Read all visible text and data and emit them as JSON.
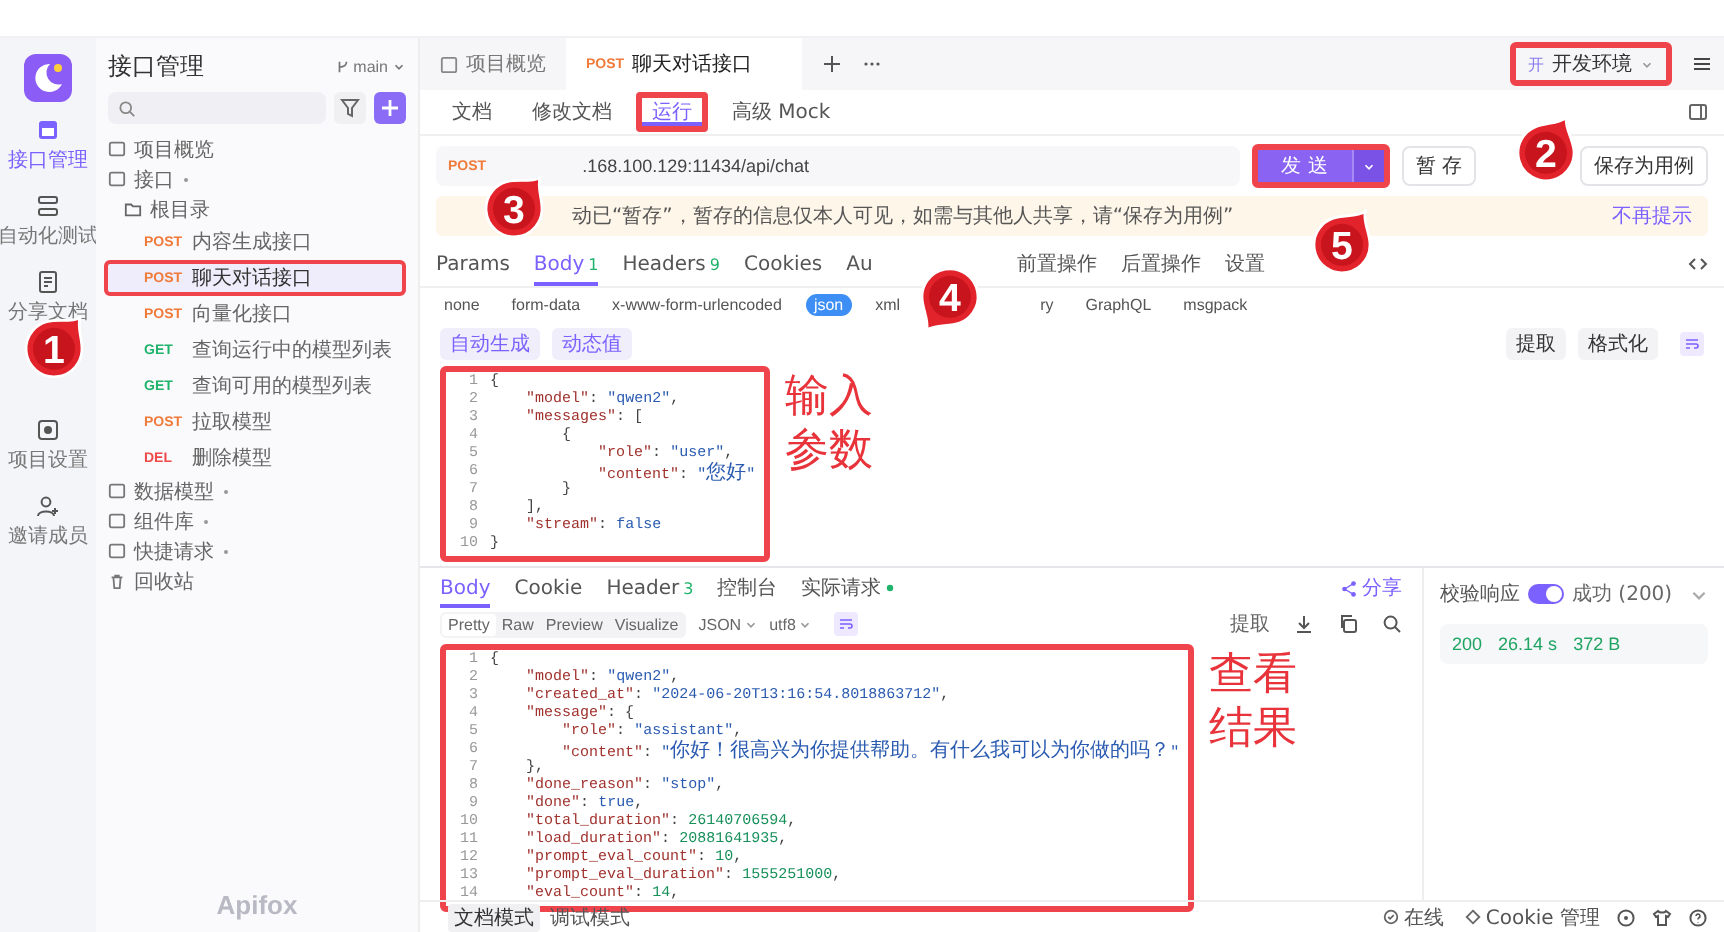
{
  "rail": {
    "items": [
      {
        "label": "接口管理",
        "selected": true
      },
      {
        "label": "自动化测试",
        "selected": false
      },
      {
        "label": "分享文档",
        "selected": false
      },
      {
        "label": "项目设置",
        "selected": false
      },
      {
        "label": "邀请成员",
        "selected": false
      }
    ]
  },
  "sidebar": {
    "title": "接口管理",
    "branch": "main",
    "tree": [
      {
        "label": "项目概览",
        "kind": "page"
      },
      {
        "label": "接口",
        "kind": "api",
        "children": [
          {
            "label": "根目录",
            "children": [
              {
                "method": "POST",
                "color": "#f07a3a",
                "label": "内容生成接口",
                "selected": false,
                "highlighted": false
              },
              {
                "method": "POST",
                "color": "#f07a3a",
                "label": "聊天对话接口",
                "selected": true,
                "highlighted": true
              },
              {
                "method": "POST",
                "color": "#f07a3a",
                "label": "向量化接口",
                "selected": false,
                "highlighted": false
              },
              {
                "method": "GET",
                "color": "#1fb36b",
                "label": "查询运行中的模型列表",
                "selected": false,
                "highlighted": false
              },
              {
                "method": "GET",
                "color": "#1fb36b",
                "label": "查询可用的模型列表",
                "selected": false,
                "highlighted": false
              },
              {
                "method": "POST",
                "color": "#f07a3a",
                "label": "拉取模型",
                "selected": false,
                "highlighted": false
              },
              {
                "method": "DEL",
                "color": "#ef4a4a",
                "label": "删除模型",
                "selected": false,
                "highlighted": false
              }
            ]
          }
        ]
      },
      {
        "label": "数据模型",
        "kind": "model"
      },
      {
        "label": "组件库",
        "kind": "lib"
      },
      {
        "label": "快捷请求",
        "kind": "quick"
      },
      {
        "label": "回收站",
        "kind": "trash"
      }
    ],
    "brand": "Apifox"
  },
  "tabs": [
    {
      "label": "项目概览",
      "selected": false
    },
    {
      "method": "POST",
      "label": "聊天对话接口",
      "selected": true
    }
  ],
  "environment": {
    "badge": "开",
    "label": "开发环境",
    "highlighted": true
  },
  "sub_tabs": [
    {
      "label": "文档",
      "selected": false,
      "highlighted": false
    },
    {
      "label": "修改文档",
      "selected": false,
      "highlighted": false
    },
    {
      "label": "运行",
      "selected": true,
      "highlighted": true
    },
    {
      "label": "高级 Mock",
      "selected": false,
      "highlighted": false
    }
  ],
  "request": {
    "method": "POST",
    "url": ".168.100.129:11434/api/chat",
    "send": "发 送",
    "send_highlighted": true,
    "save": "暂 存",
    "save_case": "保存为用例"
  },
  "notice": {
    "text": "动已“暂存”，暂存的信息仅本人可见，如需与其他人共享，请“保存为用例”",
    "dismiss": "不再提示"
  },
  "param_tabs": [
    {
      "label": "Params",
      "selected": false
    },
    {
      "label": "Body",
      "count": "1",
      "selected": true
    },
    {
      "label": "Headers",
      "count": "9",
      "selected": false
    },
    {
      "label": "Cookies",
      "selected": false
    },
    {
      "label": "Au",
      "selected": false
    },
    {
      "label": "前置操作",
      "selected": false
    },
    {
      "label": "后置操作",
      "selected": false
    },
    {
      "label": "设置",
      "selected": false
    }
  ],
  "body_types": [
    {
      "label": "none",
      "selected": false
    },
    {
      "label": "form-data",
      "selected": false
    },
    {
      "label": "x-www-form-urlencoded",
      "selected": false
    },
    {
      "label": "json",
      "selected": true
    },
    {
      "label": "xml",
      "selected": false
    },
    {
      "label": "ry",
      "selected": false
    },
    {
      "label": "GraphQL",
      "selected": false
    },
    {
      "label": "msgpack",
      "selected": false
    }
  ],
  "editor": {
    "auto": "自动生成",
    "dynamic": "动态值",
    "extract": "提取",
    "format": "格式化",
    "highlighted": true,
    "note": "输入参数",
    "lines": [
      {
        "n": "1",
        "code": "{"
      },
      {
        "n": "2",
        "code": "    \"model\": \"qwen2\","
      },
      {
        "n": "3",
        "code": "    \"messages\": ["
      },
      {
        "n": "4",
        "code": "        {"
      },
      {
        "n": "5",
        "code": "            \"role\": \"user\","
      },
      {
        "n": "6",
        "code": "            \"content\": \"您好\""
      },
      {
        "n": "7",
        "code": "        }"
      },
      {
        "n": "8",
        "code": "    ],"
      },
      {
        "n": "9",
        "code": "    \"stream\": false"
      },
      {
        "n": "10",
        "code": "}"
      }
    ]
  },
  "response": {
    "tabs": [
      {
        "label": "Body",
        "selected": true
      },
      {
        "label": "Cookie",
        "selected": false
      },
      {
        "label": "Header",
        "count": "3",
        "selected": false
      },
      {
        "label": "控制台",
        "selected": false
      },
      {
        "label": "实际请求",
        "dot": true,
        "selected": false
      }
    ],
    "share": "分享",
    "views": [
      {
        "label": "Pretty",
        "selected": true
      },
      {
        "label": "Raw",
        "selected": false
      },
      {
        "label": "Preview",
        "selected": false
      },
      {
        "label": "Visualize",
        "selected": false
      }
    ],
    "format": "JSON",
    "encoding": "utf8",
    "extract": "提取",
    "highlighted": true,
    "note": "查看结果",
    "lines": [
      {
        "n": "1",
        "code": "{"
      },
      {
        "n": "2",
        "code": "    \"model\": \"qwen2\","
      },
      {
        "n": "3",
        "code": "    \"created_at\": \"2024-06-20T13:16:54.8018863712\","
      },
      {
        "n": "4",
        "code": "    \"message\": {"
      },
      {
        "n": "5",
        "code": "        \"role\": \"assistant\","
      },
      {
        "n": "6",
        "code": "        \"content\": \"你好！很高兴为你提供帮助。有什么我可以为你做的吗？\""
      },
      {
        "n": "7",
        "code": "    },"
      },
      {
        "n": "8",
        "code": "    \"done_reason\": \"stop\","
      },
      {
        "n": "9",
        "code": "    \"done\": true,"
      },
      {
        "n": "10",
        "code": "    \"total_duration\": 26140706594,"
      },
      {
        "n": "11",
        "code": "    \"load_duration\": 20881641935,"
      },
      {
        "n": "12",
        "code": "    \"prompt_eval_count\": 10,"
      },
      {
        "n": "13",
        "code": "    \"prompt_eval_duration\": 1555251000,"
      },
      {
        "n": "14",
        "code": "    \"eval_count\": 14,"
      }
    ]
  },
  "result_panel": {
    "validate": {
      "label": "校验响应",
      "on": true
    },
    "status": "成功 (200)",
    "code": "200",
    "time": "26.14 s",
    "size": "372 B"
  },
  "bottom_bar": {
    "modes": [
      {
        "label": "文档模式",
        "selected": true
      },
      {
        "label": "调试模式",
        "selected": false
      }
    ],
    "online": "在线",
    "cookie": "Cookie 管理"
  },
  "markers": [
    "1",
    "2",
    "3",
    "4",
    "5"
  ]
}
